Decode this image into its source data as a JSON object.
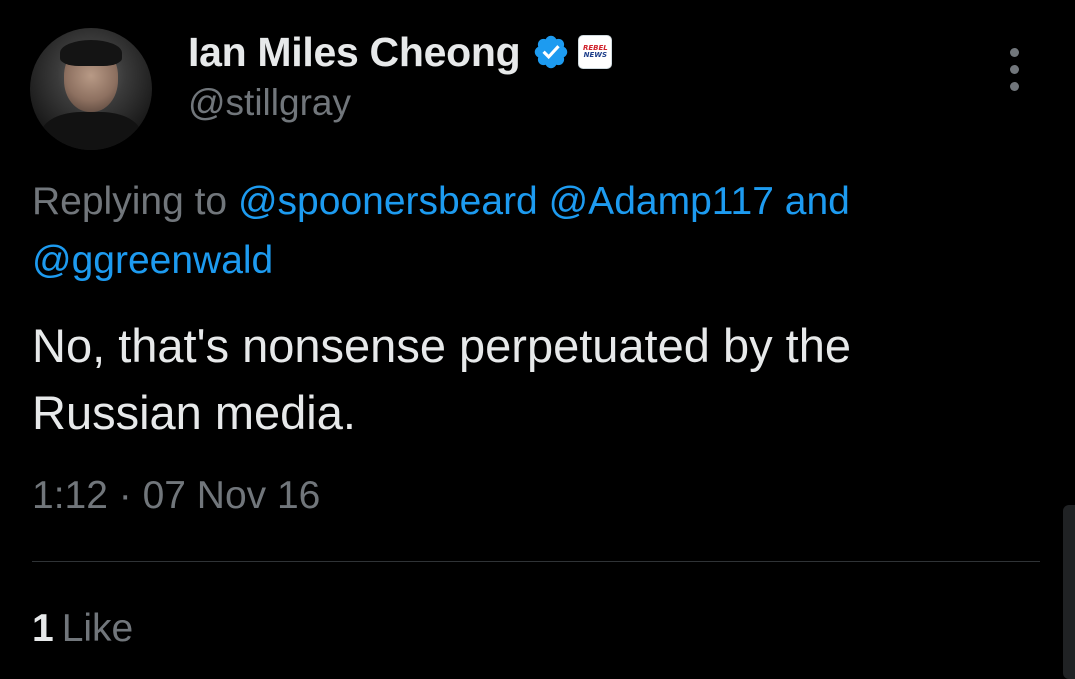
{
  "tweet": {
    "author": {
      "display_name": "Ian Miles Cheong",
      "handle": "@stillgray",
      "verified": true,
      "affiliate_badge": {
        "line1": "REBEL",
        "line2": "NEWS"
      }
    },
    "reply": {
      "prefix": "Replying to",
      "mentions": [
        "@spoonersbeard",
        "@Adamp117"
      ],
      "conjunction": "and",
      "last_mention": "@ggreenwald"
    },
    "text_line1": "No, that's nonsense perpetuated by the",
    "text_line2": "Russian media.",
    "timestamp": "1:12 · 07 Nov 16",
    "likes": {
      "count": "1",
      "label": "Like"
    }
  },
  "icons": {
    "verified": "verified-badge-icon",
    "more": "more-options-icon"
  },
  "colors": {
    "background": "#000000",
    "primary_text": "#e7e9ea",
    "secondary_text": "#71767b",
    "link": "#1d9bf0",
    "divider": "#2f3336"
  }
}
